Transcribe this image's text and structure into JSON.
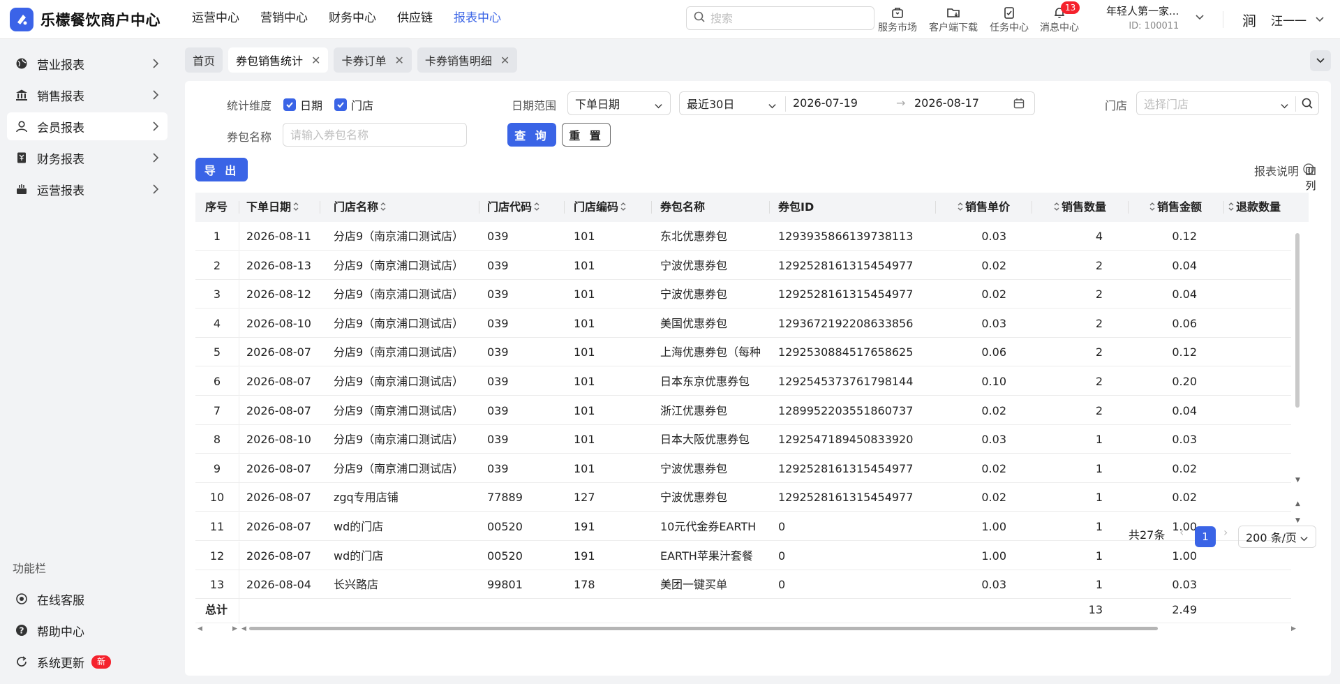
{
  "app": {
    "title": "乐檬餐饮商户中心"
  },
  "topnav": [
    {
      "label": "运营中心",
      "active": false
    },
    {
      "label": "营销中心",
      "active": false
    },
    {
      "label": "财务中心",
      "active": false
    },
    {
      "label": "供应链",
      "active": false
    },
    {
      "label": "报表中心",
      "active": true
    }
  ],
  "search": {
    "placeholder": "搜索"
  },
  "tools": [
    {
      "label": "服务市场",
      "icon": "shop-bag-icon"
    },
    {
      "label": "客户端下载",
      "icon": "folder-download-icon"
    },
    {
      "label": "任务中心",
      "icon": "clipboard-check-icon"
    },
    {
      "label": "消息中心",
      "icon": "bell-icon",
      "badge": "13"
    }
  ],
  "account": {
    "name": "年轻人第一家...",
    "id": "ID: 100011"
  },
  "user": {
    "avatar": "涧",
    "name": "汪一一"
  },
  "sidebar": {
    "items": [
      {
        "label": "营业报表",
        "icon": "globe-icon"
      },
      {
        "label": "销售报表",
        "icon": "bank-icon"
      },
      {
        "label": "会员报表",
        "icon": "person-icon",
        "active": true
      },
      {
        "label": "财务报表",
        "icon": "ledger-icon"
      },
      {
        "label": "运营报表",
        "icon": "cake-icon"
      }
    ],
    "func_title": "功能栏",
    "func_items": [
      {
        "label": "在线客服",
        "icon": "headset-icon"
      },
      {
        "label": "帮助中心",
        "icon": "help-circle-icon"
      },
      {
        "label": "系统更新",
        "icon": "refresh-icon",
        "badge": "新"
      }
    ]
  },
  "tabs": [
    {
      "label": "首页",
      "closable": false
    },
    {
      "label": "券包销售统计",
      "closable": true,
      "active": true
    },
    {
      "label": "卡券订单",
      "closable": true
    },
    {
      "label": "卡券销售明细",
      "closable": true
    }
  ],
  "filters": {
    "dimension_label": "统计维度",
    "dimension_options": [
      {
        "label": "日期",
        "checked": true
      },
      {
        "label": "门店",
        "checked": true
      }
    ],
    "date_range_label": "日期范围",
    "date_type": "下单日期",
    "preset": "最近30日",
    "start_date": "2026-07-19",
    "end_date": "2026-08-17",
    "store_label": "门店",
    "store_placeholder": "选择门店",
    "package_label": "券包名称",
    "package_placeholder": "请输入券包名称",
    "query_btn": "查 询",
    "reset_btn": "重 置",
    "export_btn": "导 出",
    "help_text": "报表说明"
  },
  "table": {
    "columns": [
      "序号",
      "下单日期",
      "门店名称",
      "门店代码",
      "门店编码",
      "券包名称",
      "券包ID",
      "销售单价",
      "销售数量",
      "销售金额",
      "退款数量"
    ],
    "rows": [
      [
        "1",
        "2026-08-11",
        "分店9（南京浦口测试店）",
        "039",
        "101",
        "东北优惠券包",
        "1293935866139738113",
        "0.03",
        "4",
        "0.12"
      ],
      [
        "2",
        "2026-08-13",
        "分店9（南京浦口测试店）",
        "039",
        "101",
        "宁波优惠券包",
        "1292528161315454977",
        "0.02",
        "2",
        "0.04"
      ],
      [
        "3",
        "2026-08-12",
        "分店9（南京浦口测试店）",
        "039",
        "101",
        "宁波优惠券包",
        "1292528161315454977",
        "0.02",
        "2",
        "0.04"
      ],
      [
        "4",
        "2026-08-10",
        "分店9（南京浦口测试店）",
        "039",
        "101",
        "美国优惠券包",
        "1293672192208633856",
        "0.03",
        "2",
        "0.06"
      ],
      [
        "5",
        "2026-08-07",
        "分店9（南京浦口测试店）",
        "039",
        "101",
        "上海优惠券包（每种",
        "1292530884517658625",
        "0.06",
        "2",
        "0.12"
      ],
      [
        "6",
        "2026-08-07",
        "分店9（南京浦口测试店）",
        "039",
        "101",
        "日本东京优惠券包",
        "1292545373761798144",
        "0.10",
        "2",
        "0.20"
      ],
      [
        "7",
        "2026-08-07",
        "分店9（南京浦口测试店）",
        "039",
        "101",
        "浙江优惠券包",
        "1289952203551860737",
        "0.02",
        "2",
        "0.04"
      ],
      [
        "8",
        "2026-08-10",
        "分店9（南京浦口测试店）",
        "039",
        "101",
        "日本大阪优惠券包",
        "1292547189450833920",
        "0.03",
        "1",
        "0.03"
      ],
      [
        "9",
        "2026-08-07",
        "分店9（南京浦口测试店）",
        "039",
        "101",
        "宁波优惠券包",
        "1292528161315454977",
        "0.02",
        "1",
        "0.02"
      ],
      [
        "10",
        "2026-08-07",
        "zgq专用店铺",
        "77889",
        "127",
        "宁波优惠券包",
        "1292528161315454977",
        "0.02",
        "1",
        "0.02"
      ],
      [
        "11",
        "2026-08-07",
        "wd的门店",
        "00520",
        "191",
        "10元代金券EARTH",
        "0",
        "1.00",
        "1",
        "1.00"
      ],
      [
        "12",
        "2026-08-07",
        "wd的门店",
        "00520",
        "191",
        "EARTH苹果汁套餐",
        "0",
        "1.00",
        "1",
        "1.00"
      ],
      [
        "13",
        "2026-08-04",
        "长兴路店",
        "99801",
        "178",
        "美团一键买单",
        "0",
        "0.03",
        "1",
        "0.03"
      ]
    ],
    "total_label": "总计",
    "total_qty": "13",
    "total_amount": "2.49",
    "col_settings": "列"
  },
  "pagination": {
    "total_text": "共27条",
    "current": "1",
    "page_size": "200 条/页"
  }
}
